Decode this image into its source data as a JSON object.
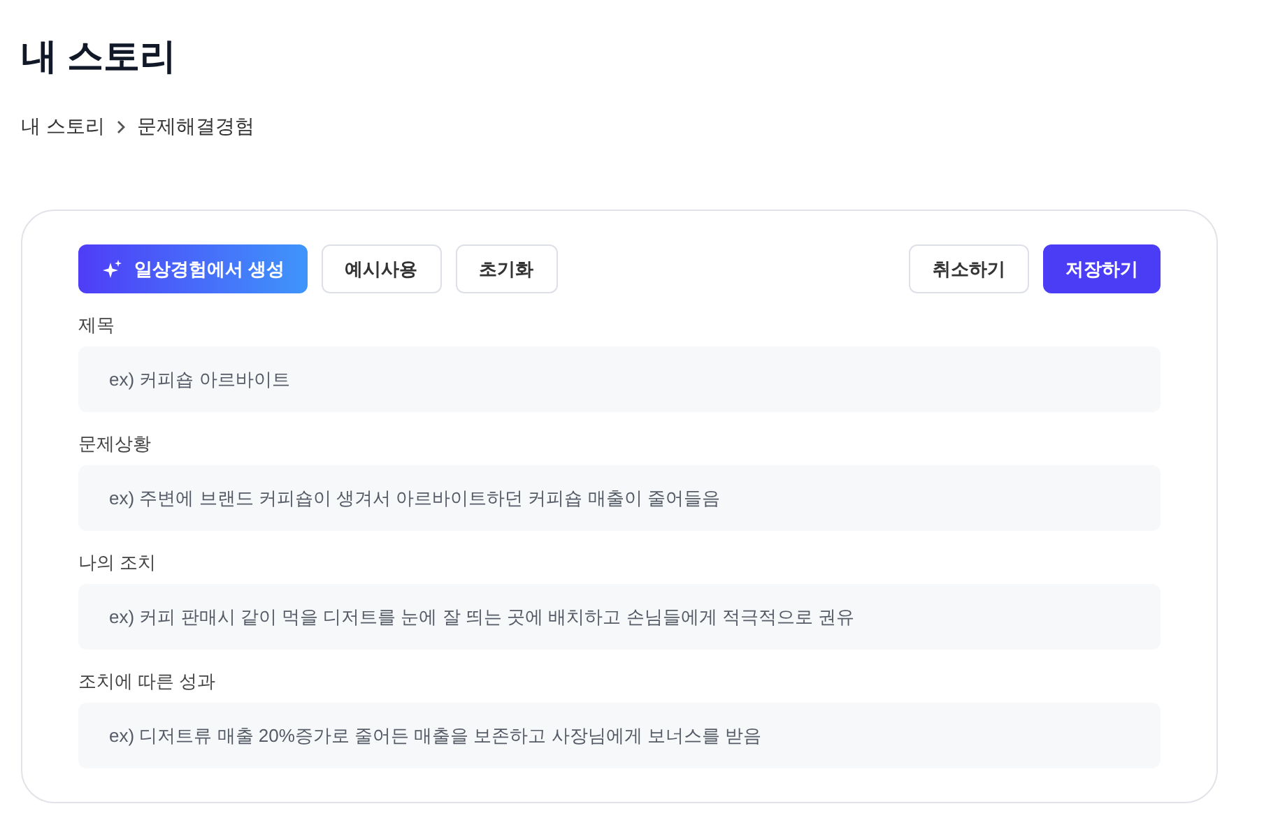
{
  "page_title": "내 스토리",
  "breadcrumb": [
    "내 스토리",
    "문제해결경험"
  ],
  "toolbar": {
    "left": [
      {
        "kind": "generate",
        "label": "일상경험에서 생성"
      },
      {
        "kind": "outline",
        "label": "예시사용"
      },
      {
        "kind": "outline",
        "label": "초기화"
      }
    ],
    "right": [
      {
        "kind": "outline",
        "label": "취소하기"
      },
      {
        "kind": "primary",
        "label": "저장하기"
      }
    ]
  },
  "fields": [
    {
      "label": "제목",
      "placeholder": "ex) 커피숍 아르바이트"
    },
    {
      "label": "문제상황",
      "placeholder": "ex) 주변에 브랜드 커피숍이 생겨서 아르바이트하던 커피숍 매출이 줄어들음"
    },
    {
      "label": "나의 조치",
      "placeholder": "ex) 커피 판매시 같이 먹을 디저트를 눈에 잘 띄는 곳에 배치하고 손님들에게 적극적으로 권유"
    },
    {
      "label": "조치에 따른 성과",
      "placeholder": "ex) 디저트류 매출 20%증가로 줄어든 매출을 보존하고 사장님에게 보너스를 받음"
    }
  ]
}
